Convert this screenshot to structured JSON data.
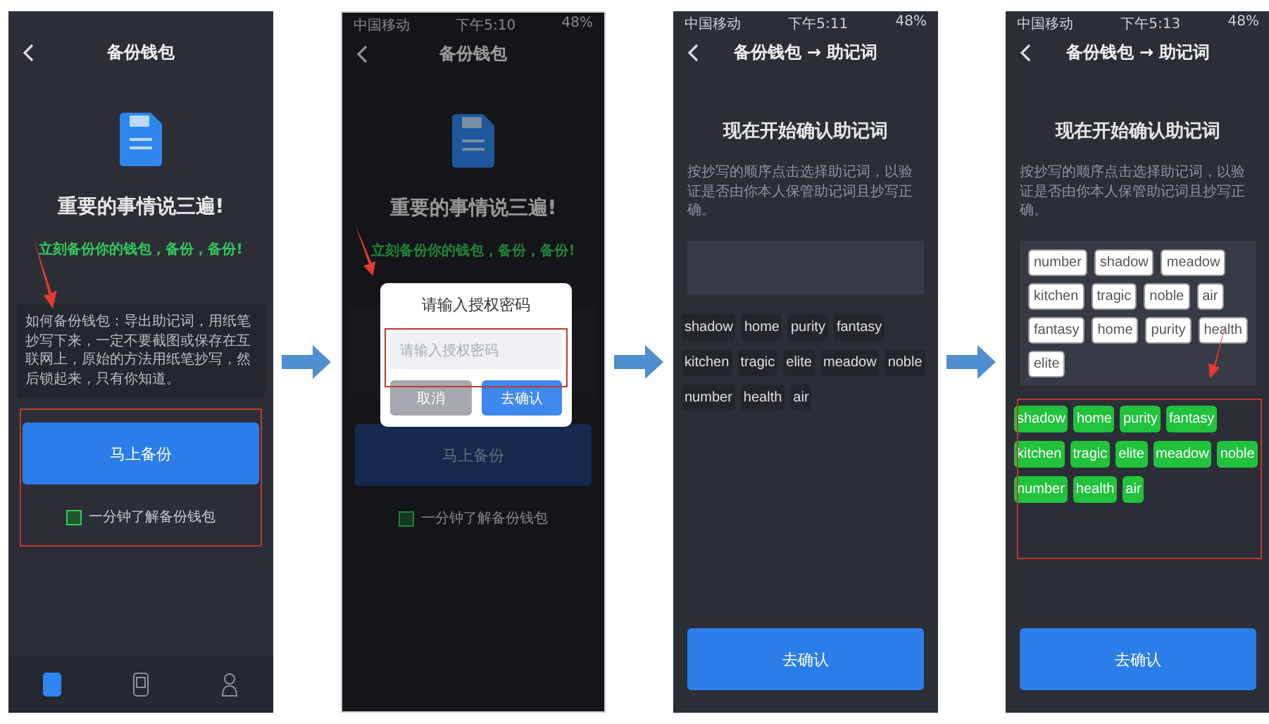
{
  "screens": [
    {
      "kind": "backup",
      "title": "备份钱包",
      "heading": "重要的事情说三遍!",
      "subheading": "立刻备份你的钱包，备份，备份!",
      "tip": "如何备份钱包：导出助记词，用纸笔抄写下来，一定不要截图或保存在互联网上，原始的方法用纸笔抄写，然后锁起来，只有你知道。",
      "primary_button": "马上备份",
      "help_link": "一分钟了解备份钱包",
      "tabs": [
        {
          "selected": true
        },
        {
          "selected": false
        },
        {
          "selected": false
        }
      ]
    },
    {
      "kind": "password_dialog",
      "status_bar": {
        "carrier": "中国移动",
        "time": "下午5:10",
        "battery": "48%"
      },
      "title": "备份钱包",
      "heading": "重要的事情说三遍!",
      "subheading": "立刻备份你的钱包，备份，备份!",
      "primary_button": "马上备份",
      "help_link": "一分钟了解备份钱包",
      "dialog": {
        "title": "请输入授权密码",
        "placeholder": "请输入授权密码",
        "cancel": "取消",
        "confirm": "去确认"
      }
    },
    {
      "kind": "confirm_words",
      "status_bar": {
        "carrier": "中国移动",
        "time": "下午5:11",
        "battery": "48%"
      },
      "title": "备份钱包 → 助记词",
      "heading": "现在开始确认助记词",
      "description": "按抄写的顺序点击选择助记词，以验证是否由你本人保管助记词且抄写正确。",
      "words": [
        {
          "text": "shadow",
          "selected": false
        },
        {
          "text": "home",
          "selected": false
        },
        {
          "text": "purity",
          "selected": false
        },
        {
          "text": "fantasy",
          "selected": false
        },
        {
          "text": "kitchen",
          "selected": false
        },
        {
          "text": "tragic",
          "selected": false
        },
        {
          "text": "elite",
          "selected": false
        },
        {
          "text": "meadow",
          "selected": false
        },
        {
          "text": "noble",
          "selected": false
        },
        {
          "text": "number",
          "selected": false
        },
        {
          "text": "health",
          "selected": false
        },
        {
          "text": "air",
          "selected": false
        }
      ],
      "primary_button": "去确认"
    },
    {
      "kind": "confirm_words",
      "status_bar": {
        "carrier": "中国移动",
        "time": "下午5:13",
        "battery": "48%"
      },
      "title": "备份钱包 → 助记词",
      "heading": "现在开始确认助记词",
      "description": "按抄写的顺序点击选择助记词，以验证是否由你本人保管助记词且抄写正确。",
      "picked": [
        "number",
        "shadow",
        "meadow",
        "kitchen",
        "tragic",
        "noble",
        "air",
        "fantasy",
        "home",
        "purity",
        "health",
        "elite"
      ],
      "words": [
        {
          "text": "shadow",
          "selected": true
        },
        {
          "text": "home",
          "selected": true
        },
        {
          "text": "purity",
          "selected": true
        },
        {
          "text": "fantasy",
          "selected": true
        },
        {
          "text": "kitchen",
          "selected": true
        },
        {
          "text": "tragic",
          "selected": true
        },
        {
          "text": "elite",
          "selected": true
        },
        {
          "text": "meadow",
          "selected": true
        },
        {
          "text": "noble",
          "selected": true
        },
        {
          "text": "number",
          "selected": true
        },
        {
          "text": "health",
          "selected": true
        },
        {
          "text": "air",
          "selected": true
        }
      ],
      "primary_button": "去确认"
    }
  ]
}
